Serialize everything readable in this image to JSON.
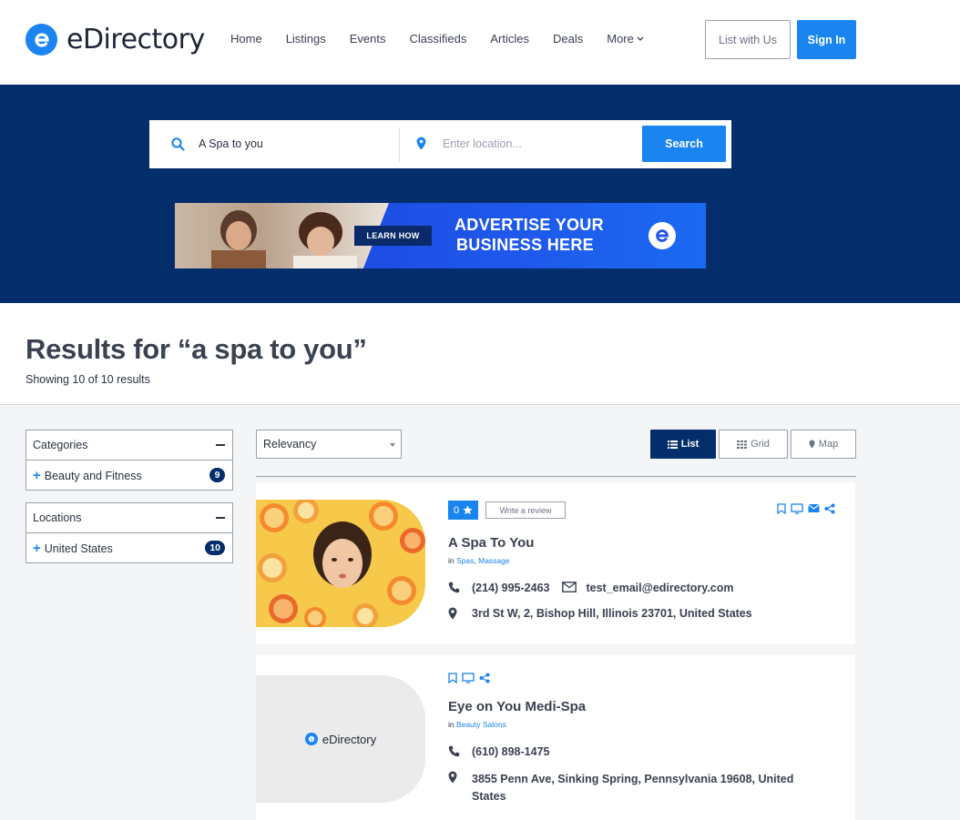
{
  "brand": {
    "name": "eDirectory",
    "accent": "#1a84f0",
    "navy": "#042e6b"
  },
  "nav": [
    "Home",
    "Listings",
    "Events",
    "Classifieds",
    "Articles",
    "Deals",
    "More"
  ],
  "header_buttons": {
    "list_with_us": "List with Us",
    "sign_in": "Sign In"
  },
  "search": {
    "query": "A Spa to you",
    "location_placeholder": "Enter location...",
    "button": "Search"
  },
  "ad": {
    "cta": "LEARN HOW",
    "line1": "ADVERTISE YOUR",
    "line2": "BUSINESS HERE"
  },
  "results": {
    "title": "Results for “a spa to you”",
    "count": "Showing 10 of 10 results"
  },
  "filters": [
    {
      "title": "Categories",
      "items": [
        {
          "label": "Beauty and Fitness",
          "count": "9"
        }
      ]
    },
    {
      "title": "Locations",
      "items": [
        {
          "label": "United States",
          "count": "10"
        }
      ]
    }
  ],
  "sort": {
    "selected": "Relevancy"
  },
  "views": {
    "list": "List",
    "grid": "Grid",
    "map": "Map",
    "active": "List"
  },
  "listings": [
    {
      "rating": "0",
      "review_label": "Write a review",
      "title": "A Spa To You",
      "in": "in",
      "categories": [
        "Spas",
        "Massage"
      ],
      "phone": "(214) 995-2463",
      "email": "test_email@edirectory.com",
      "address": "3rd St W, 2, Bishop Hill, Illinois 23701, United States"
    },
    {
      "title": "Eye on You Medi-Spa",
      "in": "in",
      "categories": [
        "Beauty Salons"
      ],
      "phone": "(610) 898-1475",
      "address_line1": "3855 Penn Ave, Sinking Spring, Pennsylvania 19608, United",
      "address_line2": "States",
      "placeholder_logo": "eDirectory"
    }
  ]
}
